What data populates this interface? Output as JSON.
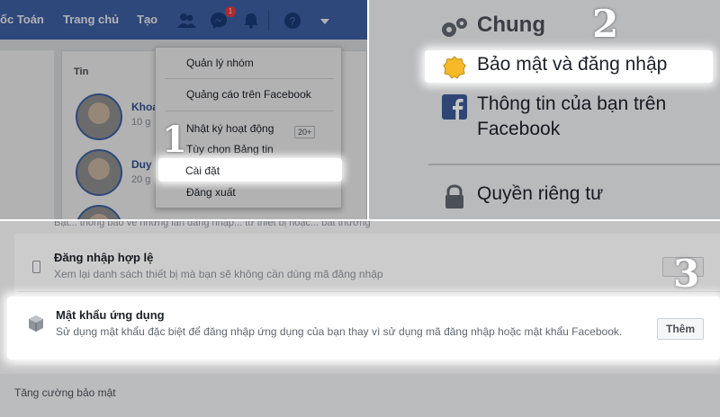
{
  "panel1": {
    "nav": {
      "profile": "ốc Toán",
      "home": "Trang chủ",
      "create": "Tạo"
    },
    "messenger_badge": "1",
    "section_title": "Tin",
    "friends": [
      {
        "name": "Khoa",
        "sub": "10 g"
      },
      {
        "name": "Duy",
        "sub": "20 g"
      }
    ],
    "menu": {
      "manage_groups": "Quản lý nhóm",
      "advertise": "Quảng cáo trên Facebook",
      "activity_log": "Nhật ký hoạt động",
      "activity_count": "20+",
      "news_feed_prefs": "Tùy chọn Bảng tin",
      "settings": "Cài đặt",
      "logout": "Đăng xuất"
    },
    "step": "1"
  },
  "panel2": {
    "general": "Chung",
    "security_login": "Bảo mật và đăng nhập",
    "your_info": "Thông tin của bạn trên Facebook",
    "privacy": "Quyền riêng tư",
    "step": "2"
  },
  "panel3": {
    "cut_text": "Bật... thông báo về những lần đăng nhập... từ thiết bị hoặc... bất thường",
    "authorized_logins_title": "Đăng nhập hợp lệ",
    "authorized_logins_desc": "Xem lại danh sách thiết bị mà bạn sẽ không cần dùng mã đăng nhập",
    "app_passwords_title": "Mật khẩu ứng dụng",
    "app_passwords_desc": "Sử dụng mật khẩu đặc biệt để đăng nhập ứng dụng của bạn thay vì sử dụng mã đăng nhập hoặc mật khẩu Facebook.",
    "add_button": "Thêm",
    "footer": "Tăng cường bảo mật",
    "step": "3"
  }
}
